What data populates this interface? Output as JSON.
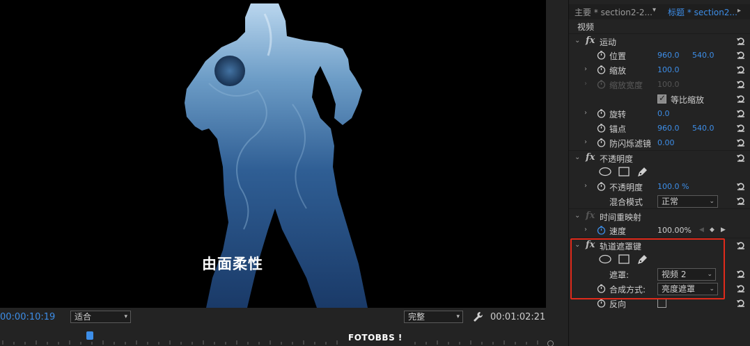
{
  "monitor": {
    "caption": "由面柔性",
    "timecode_current": "00:00:10:19",
    "timecode_duration": "00:01:02:21",
    "zoom_level": "适合",
    "playback_quality": "完整",
    "watermark": "FOTOBBS !"
  },
  "effect_controls": {
    "tab_master": "主要 * section2-2...",
    "tab_sequence": "标题 * section2...",
    "track_label": "视频",
    "motion": {
      "title": "运动",
      "position_label": "位置",
      "position_x": "960.0",
      "position_y": "540.0",
      "scale_label": "缩放",
      "scale_value": "100.0",
      "scale_width_label": "缩放宽度",
      "scale_width_value": "100.0",
      "uniform_scale_label": "等比缩放",
      "rotation_label": "旋转",
      "rotation_value": "0.0",
      "anchor_label": "锚点",
      "anchor_x": "960.0",
      "anchor_y": "540.0",
      "antiflicker_label": "防闪烁滤镜",
      "antiflicker_value": "0.00"
    },
    "opacity": {
      "title": "不透明度",
      "opacity_label": "不透明度",
      "opacity_value": "100.0 %",
      "blend_mode_label": "混合模式",
      "blend_mode_value": "正常"
    },
    "time_remap": {
      "title": "时间重映射",
      "speed_label": "速度",
      "speed_value": "100.00%"
    },
    "track_matte": {
      "title": "轨道遮罩键",
      "matte_label": "遮罩:",
      "matte_value": "视频 2",
      "composite_label": "合成方式:",
      "composite_value": "亮度遮罩",
      "reverse_label": "反向"
    }
  },
  "colors": {
    "accent_blue": "#3d8ee8",
    "highlight_red": "#e02a1b",
    "panel_bg": "#232323"
  }
}
